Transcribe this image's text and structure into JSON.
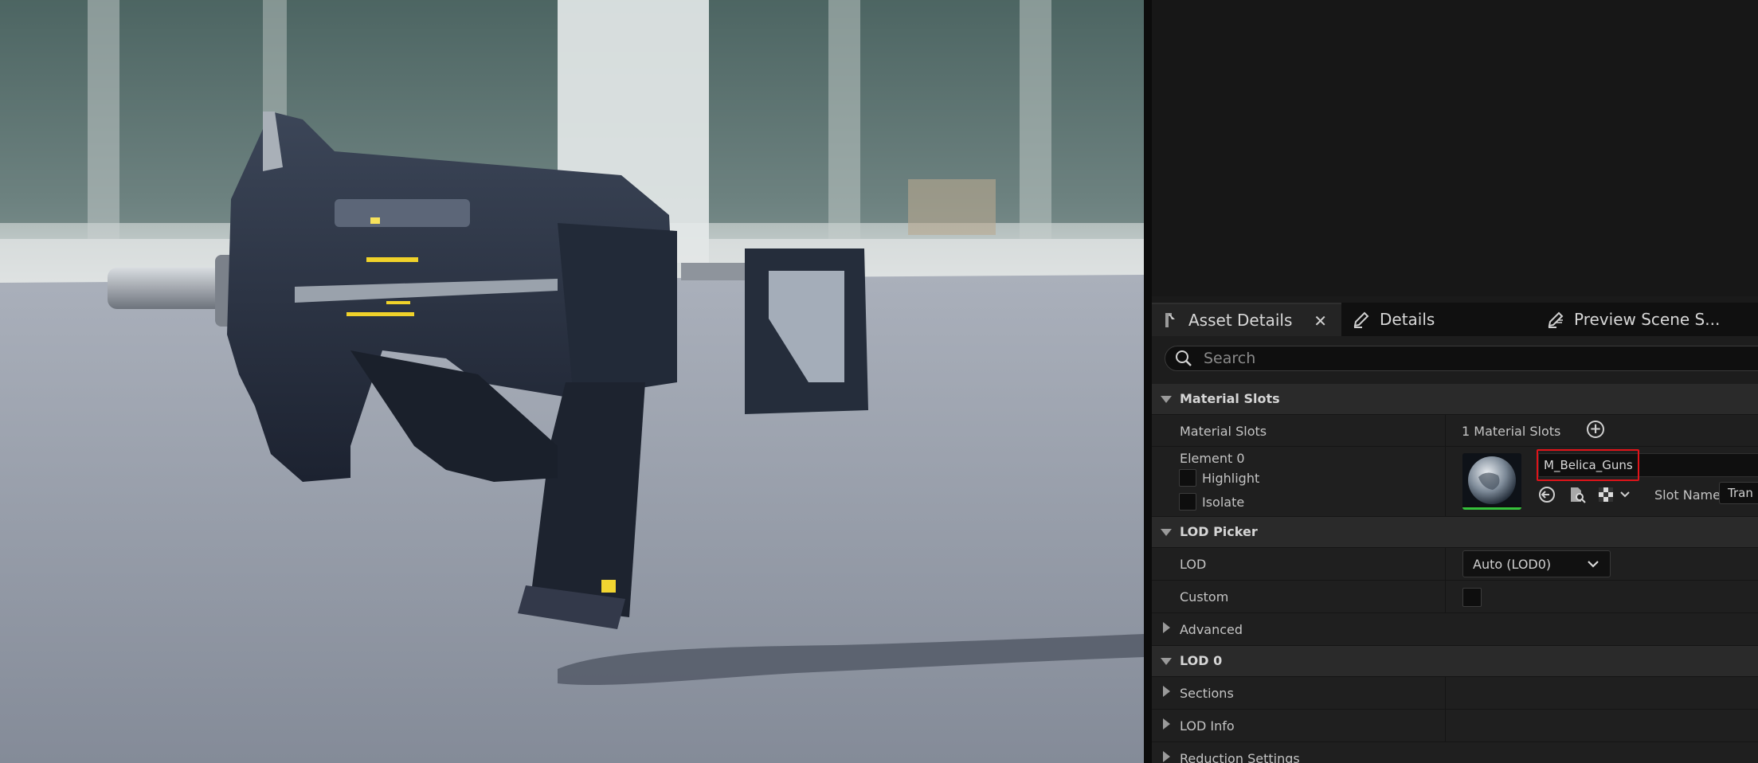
{
  "tabs": {
    "asset_details": "Asset Details",
    "details": "Details",
    "preview_scene": "Preview Scene S..."
  },
  "search": {
    "placeholder": "Search"
  },
  "material_slots": {
    "header": "Material Slots",
    "row_label": "Material Slots",
    "count_text": "1 Material Slots",
    "element_label": "Element 0",
    "highlight_label": "Highlight",
    "isolate_label": "Isolate",
    "material_name": "M_Belica_Guns",
    "slot_name_label": "Slot Name",
    "slot_name_value": "Tran"
  },
  "lod_picker": {
    "header": "LOD Picker",
    "lod_label": "LOD",
    "lod_value": "Auto (LOD0)",
    "custom_label": "Custom"
  },
  "advanced": {
    "label": "Advanced"
  },
  "lod0": {
    "header": "LOD 0",
    "sections_label": "Sections",
    "lod_info_label": "LOD Info",
    "reduction_label": "Reduction Settings"
  },
  "colors": {
    "highlight_border": "#e0141a",
    "thumb_underline": "#35c23d",
    "panel_bg": "#1a1a1a"
  },
  "icons": {
    "tab_asset": "asset-details-icon",
    "tab_details": "details-pencil-icon",
    "tab_scene": "preview-scene-icon",
    "search": "search-icon",
    "add": "plus-circle-icon",
    "browse": "use-selected-arrow-icon",
    "find": "browse-folder-icon",
    "checker": "checker-icon"
  }
}
